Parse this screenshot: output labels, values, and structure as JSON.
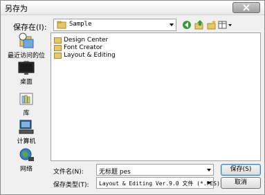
{
  "window": {
    "title": "另存为"
  },
  "toolbar": {
    "lookin_label": "保存在(I):",
    "lookin_value": "Sample",
    "icons": [
      "back-icon",
      "up-folder-icon",
      "new-folder-icon",
      "views-menu-icon"
    ]
  },
  "places": [
    {
      "label": "最近访问的位置",
      "icon": "recent-places-icon"
    },
    {
      "label": "桌面",
      "icon": "desktop-icon"
    },
    {
      "label": "库",
      "icon": "libraries-icon"
    },
    {
      "label": "计算机",
      "icon": "computer-icon"
    },
    {
      "label": "网络",
      "icon": "network-icon"
    }
  ],
  "files": [
    {
      "name": "Design Center"
    },
    {
      "name": "Font Creator"
    },
    {
      "name": "Layout & Editing"
    }
  ],
  "bottom": {
    "filename_label": "文件名(N):",
    "filename_value": "无标题 pes",
    "filetype_label": "保存类型(T):",
    "filetype_value": "Layout & Editing Ver.9.0 文件 (*.PES)",
    "save_label": "保存(S)",
    "cancel_label": "取消"
  }
}
